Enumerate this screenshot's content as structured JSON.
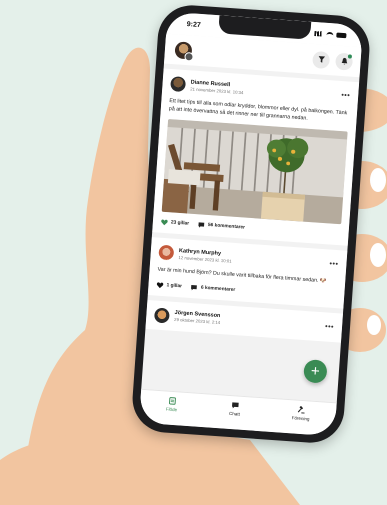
{
  "status_bar": {
    "time": "9:27"
  },
  "colors": {
    "accent": "#3a8b54",
    "background": "#e4f0ea",
    "skin": "#f2c5a0"
  },
  "header": {
    "filter_icon": "filter-icon",
    "notification_icon": "bell-icon"
  },
  "posts": [
    {
      "author": "Dianne Russell",
      "date": "21 november 2023 kl. 10:34",
      "text": "Ett litet tips till alla som odlar kryddor, blommor eller dyl. på balkongen. Tänk på att inte övervattna så det rinner ner till grannarna nedan.",
      "likes": "23 gillar",
      "comments": "56 kommentarer"
    },
    {
      "author": "Kathryn Murphy",
      "date": "12 november 2023 kl. 10:01",
      "text": "Var är min hund Björn? Du skulle varit tillbaka för flera timmar sedan. 🐶",
      "likes": "1 gillar",
      "comments": "6 kommentarer"
    },
    {
      "author": "Jörgen Svensson",
      "date": "29 oktober 2023 kl. 2:14"
    }
  ],
  "more_label": "•••",
  "fab_label": "+",
  "tabs": [
    {
      "label": "Flöde",
      "icon": "feed-icon"
    },
    {
      "label": "Chatt",
      "icon": "chat-icon"
    },
    {
      "label": "Förening",
      "icon": "gavel-icon"
    }
  ]
}
